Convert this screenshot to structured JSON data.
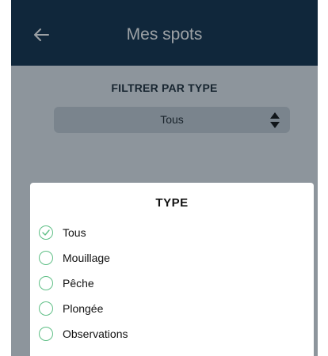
{
  "header": {
    "back_icon": "arrow-left-icon",
    "title": "Mes spots"
  },
  "filter": {
    "label": "FILTRER PAR TYPE",
    "selected": "Tous",
    "arrows_icon": "sort-arrows-icon"
  },
  "dialog": {
    "title": "TYPE",
    "options": [
      {
        "label": "Tous",
        "selected": true
      },
      {
        "label": "Mouillage",
        "selected": false
      },
      {
        "label": "Pêche",
        "selected": false
      },
      {
        "label": "Plongée",
        "selected": false
      },
      {
        "label": "Observations",
        "selected": false
      }
    ]
  },
  "colors": {
    "header_bg": "#0e2e49",
    "radio_accent": "#5fbf86"
  }
}
